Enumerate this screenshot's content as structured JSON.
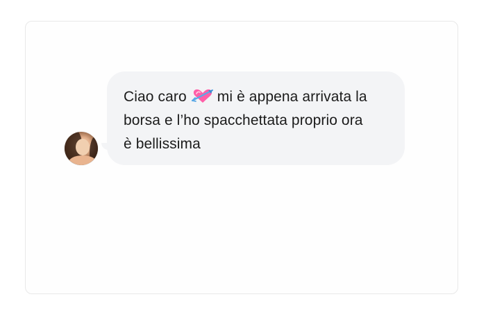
{
  "conversation": {
    "message": {
      "line1_before": "Ciao caro",
      "line1_after": "mi è appena arrivata la",
      "line2": "borsa e l’ho spacchettata proprio ora",
      "line3": "è bellissima",
      "emoji": "heart-with-arrow-icon"
    }
  },
  "colors": {
    "bubble": "#f3f4f6",
    "text": "#1b1b1b",
    "card_border": "#e8e8e8",
    "emoji_heart": "#ff5fa8",
    "emoji_arrow": "#5aa9e6"
  }
}
